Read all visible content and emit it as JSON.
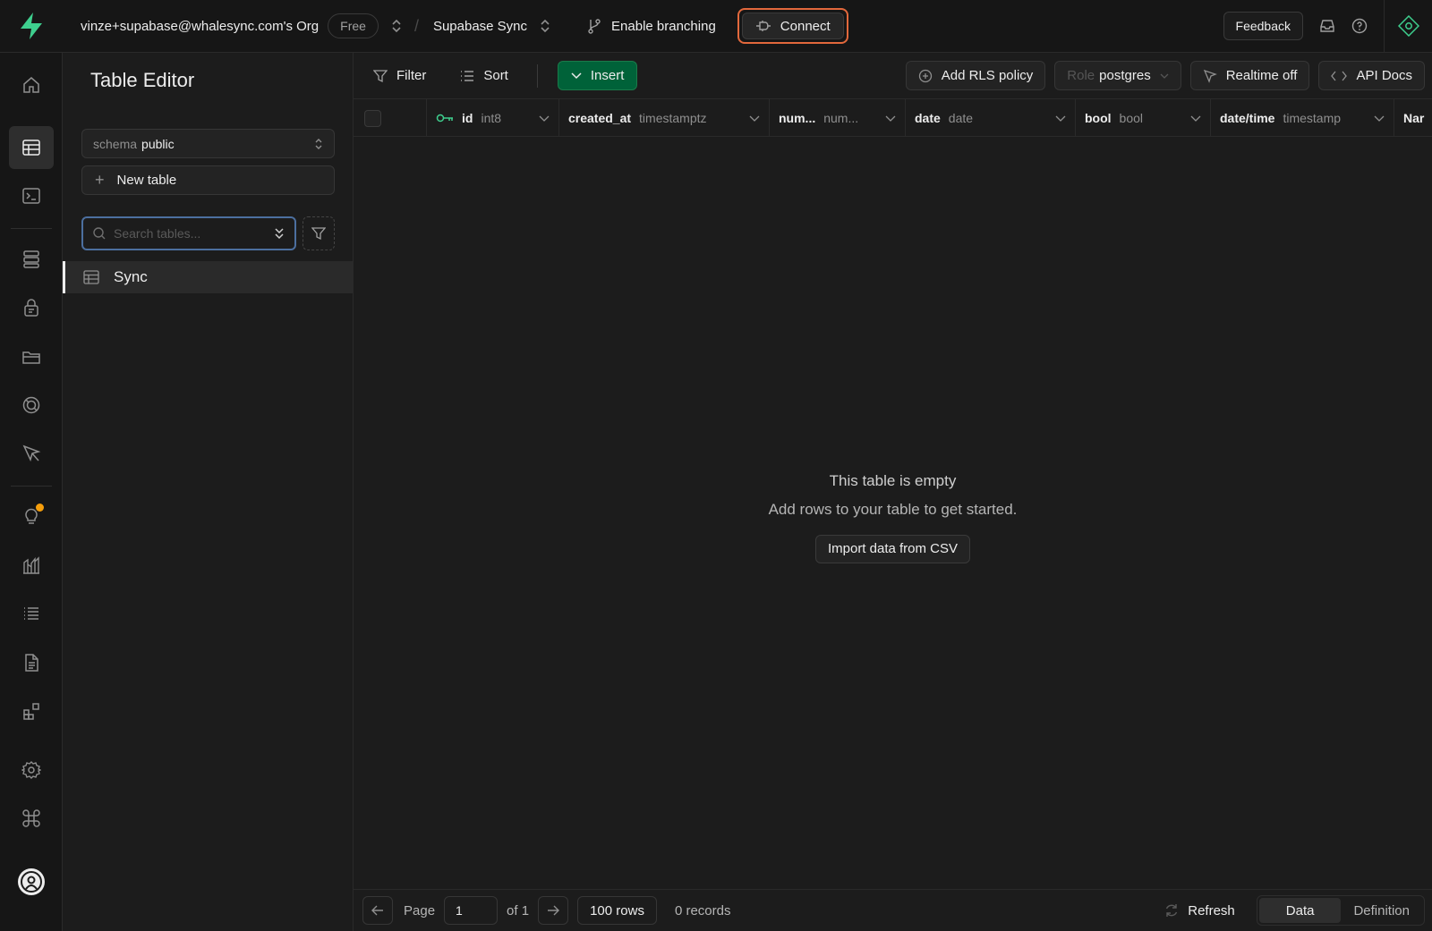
{
  "topbar": {
    "org_name": "vinze+supabase@whalesync.com's Org",
    "plan": "Free",
    "project_name": "Supabase Sync",
    "branching_label": "Enable branching",
    "connect_label": "Connect",
    "feedback_label": "Feedback"
  },
  "sidebar": {
    "title": "Table Editor",
    "schema_label": "schema",
    "schema_value": "public",
    "new_table_label": "New table",
    "search_placeholder": "Search tables...",
    "tables": [
      {
        "name": "Sync"
      }
    ]
  },
  "toolbar": {
    "filter_label": "Filter",
    "sort_label": "Sort",
    "insert_label": "Insert",
    "rls_label": "Add RLS policy",
    "role_label": "Role",
    "role_value": "postgres",
    "realtime_label": "Realtime off",
    "api_docs_label": "API Docs"
  },
  "columns": [
    {
      "name": "id",
      "type": "int8",
      "primary_key": true
    },
    {
      "name": "created_at",
      "type": "timestamptz"
    },
    {
      "name": "num...",
      "type": "num..."
    },
    {
      "name": "date",
      "type": "date"
    },
    {
      "name": "bool",
      "type": "bool"
    },
    {
      "name": "date/time",
      "type": "timestamp"
    },
    {
      "name": "Nar",
      "type": ""
    }
  ],
  "empty_state": {
    "title": "This table is empty",
    "subtitle": "Add rows to your table to get started.",
    "import_label": "Import data from CSV"
  },
  "footer": {
    "page_label": "Page",
    "page_value": "1",
    "of_label": "of 1",
    "rows_label": "100 rows",
    "records_label": "0 records",
    "refresh_label": "Refresh",
    "tab_data": "Data",
    "tab_definition": "Definition"
  },
  "colors": {
    "brand_green": "#3ecf8e",
    "insert_green": "#006239",
    "connect_highlight": "#e2683c",
    "notification_dot": "#f59e0b"
  },
  "rail_icons": [
    "home-icon",
    "table-editor-icon",
    "sql-editor-icon",
    "database-icon",
    "auth-icon",
    "storage-icon",
    "edge-functions-icon",
    "realtime-icon",
    "advisors-icon",
    "reports-icon",
    "logs-icon",
    "api-docs-icon",
    "integrations-icon",
    "settings-icon",
    "command-icon",
    "user-avatar-icon"
  ]
}
